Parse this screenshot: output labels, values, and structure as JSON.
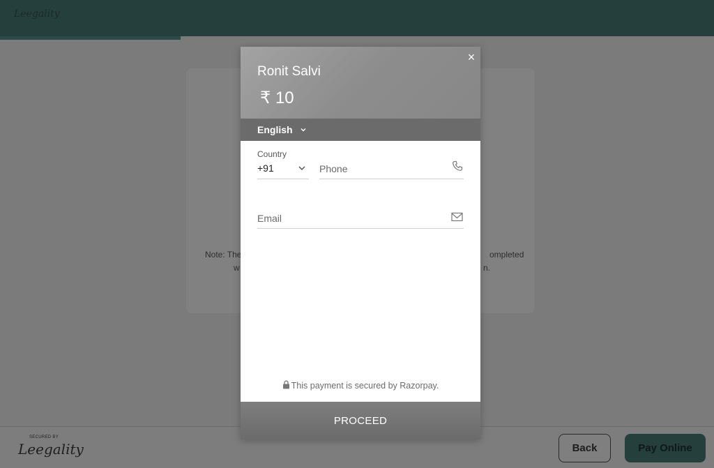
{
  "background": {
    "brand_logo": "Leegality",
    "card_note_line1": "Note: The",
    "card_note_line1_end": "ompleted",
    "card_note_line2_start": "w",
    "card_note_line2_end": "n.",
    "footer": {
      "secured_by": "SECURED BY",
      "logo": "Leegality",
      "back_label": "Back",
      "pay_label": "Pay Online"
    },
    "colors": {
      "brand_dark": "#253f3d",
      "overlay": "#7b7b7b"
    }
  },
  "modal": {
    "merchant_name": "Ronit Salvi",
    "amount": "₹ 10",
    "language": "English",
    "country_label": "Country",
    "country_code": "+91",
    "phone_placeholder": "Phone",
    "email_placeholder": "Email",
    "secure_note": "This payment is secured by Razorpay.",
    "proceed_label": "PROCEED",
    "close_glyph": "×",
    "icons": [
      "close-icon",
      "chevron-down-icon",
      "phone-icon",
      "mail-icon",
      "lock-icon"
    ]
  }
}
